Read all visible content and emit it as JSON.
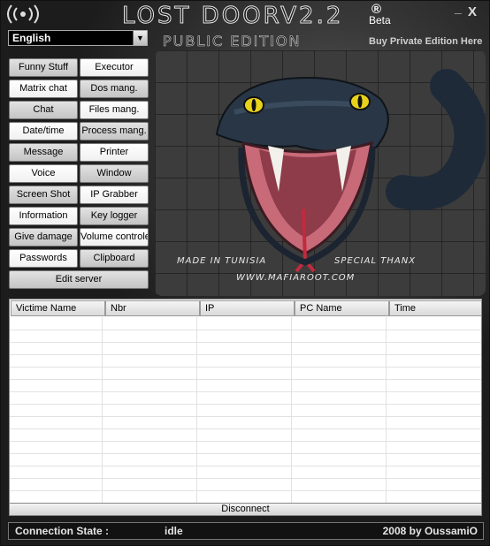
{
  "window": {
    "title": "LOST DOORV2.2",
    "registered": "®",
    "beta": "Beta",
    "minimize": "_",
    "close": "X",
    "edition": "PUBLIC EDITION",
    "buy_link": "Buy Private Edition Here"
  },
  "language": {
    "selected": "English"
  },
  "buttons": {
    "funny_stuff": "Funny Stuff",
    "executor": "Executor",
    "matrix_chat": "Matrix chat",
    "dos_mang": "Dos mang.",
    "chat": "Chat",
    "files_mang": "Files mang.",
    "date_time": "Date/time",
    "process_mang": "Process mang.",
    "message": "Message",
    "printer": "Printer",
    "voice": "Voice",
    "window": "Window",
    "screen_shot": "Screen Shot",
    "ip_grabber": "IP Grabber",
    "information": "Information",
    "key_logger": "Key logger",
    "give_damage": "Give damage",
    "volume_controle": "Volume controle",
    "passwords": "Passwords",
    "clipboard": "Clipboard",
    "edit_server": "Edit server"
  },
  "banner": {
    "made_in": "MADE IN TUNISIA",
    "thanks": "SPECIAL THANX",
    "url": "WWW.MAFIAROOT.COM"
  },
  "table": {
    "columns": [
      "Victime Name",
      "Nbr",
      "IP",
      "PC Name",
      "Time"
    ],
    "rows": []
  },
  "disconnect_label": "Disconnect",
  "status": {
    "label": "Connection State :",
    "value": "idle",
    "credit": "2008 by OussamiO"
  },
  "colors": {
    "snake_eye": "#e8d21a",
    "mouth": "#c96a78",
    "background": "#2b2b2b"
  }
}
